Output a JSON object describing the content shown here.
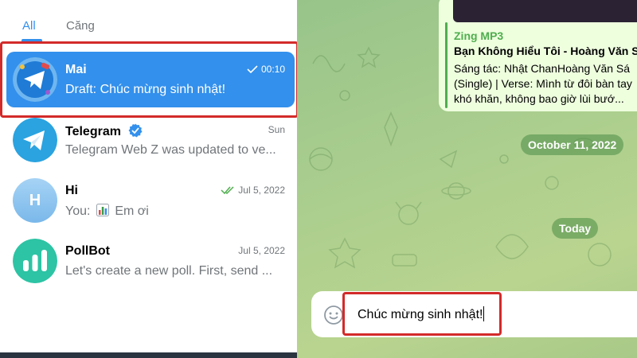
{
  "folders": {
    "all": "All",
    "cang": "Căng"
  },
  "chats": [
    {
      "name": "Mai",
      "time": "00:10",
      "preview": "Draft: Chúc mừng sinh nhật!",
      "status": "sent-check",
      "selected": true
    },
    {
      "name": "Telegram",
      "time": "Sun",
      "preview": "Telegram Web Z was updated to ve...",
      "verified": true
    },
    {
      "name": "Hi",
      "time": "Jul 5, 2022",
      "preview_prefix": "You:",
      "preview": "Em ơi",
      "preview_icon": "bar-chart-emoji",
      "status": "read-double-check",
      "avatar_letter": "H"
    },
    {
      "name": "PollBot",
      "time": "Jul 5, 2022",
      "preview": "Let's create a new poll. First, send ..."
    }
  ],
  "message": {
    "site": "Zing MP3",
    "title": "Bạn Không Hiểu Tôi - Hoàng Văn Sa",
    "desc_lines": [
      "Sáng tác: Nhật ChanHoàng Văn Sá",
      "(Single) | Verse: Mình từ đôi bàn tay",
      "khó khăn, không bao giờ lùi bướ..."
    ]
  },
  "date_separators": [
    "October 11, 2022",
    "Today"
  ],
  "composer": {
    "text": "Chúc mừng sinh nhật!"
  },
  "colors": {
    "accent": "#3390ec",
    "annotation_red": "#d32a2a",
    "link_green": "#4fae4e"
  }
}
